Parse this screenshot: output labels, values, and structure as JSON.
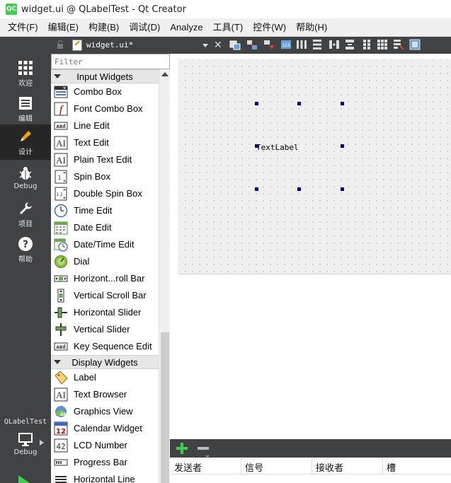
{
  "window": {
    "title": "widget.ui @ QLabelTest - Qt Creator",
    "app_icon_text": "QC"
  },
  "menubar": {
    "items": [
      "文件(F)",
      "编辑(E)",
      "构建(B)",
      "调试(D)",
      "Analyze",
      "工具(T)",
      "控件(W)",
      "帮助(H)"
    ]
  },
  "modes": {
    "items": [
      {
        "label": "欢迎",
        "icon": "grid-icon"
      },
      {
        "label": "编辑",
        "icon": "document-icon"
      },
      {
        "label": "设计",
        "icon": "pencil-icon",
        "active": true
      },
      {
        "label": "Debug",
        "icon": "bug-icon"
      },
      {
        "label": "项目",
        "icon": "wrench-icon"
      },
      {
        "label": "帮助",
        "icon": "help-icon"
      }
    ],
    "project_label": "QLabelTest",
    "target_label": "Debug"
  },
  "widgetbox": {
    "filter_placeholder": "Filter",
    "categories": [
      {
        "name": "Input Widgets",
        "items": [
          "Combo Box",
          "Font Combo Box",
          "Line Edit",
          "Text Edit",
          "Plain Text Edit",
          "Spin Box",
          "Double Spin Box",
          "Time Edit",
          "Date Edit",
          "Date/Time Edit",
          "Dial",
          "Horizont...roll Bar",
          "Vertical Scroll Bar",
          "Horizontal Slider",
          "Vertical Slider",
          "Key Sequence Edit"
        ]
      },
      {
        "name": "Display Widgets",
        "items": [
          "Label",
          "Text Browser",
          "Graphics View",
          "Calendar Widget",
          "LCD Number",
          "Progress Bar",
          "Horizontal Line"
        ]
      }
    ]
  },
  "editor": {
    "tab_name": "widget.ui*",
    "form_label_text": "TextLabel"
  },
  "signals_slots": {
    "columns": [
      "发送者",
      "信号",
      "接收者",
      "槽"
    ]
  }
}
